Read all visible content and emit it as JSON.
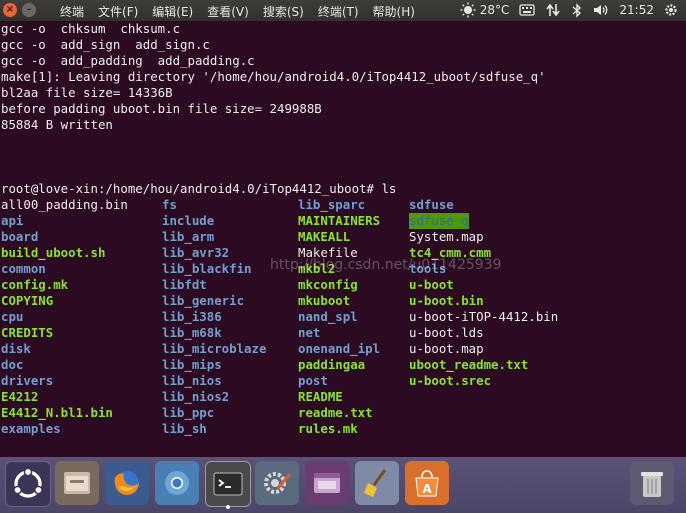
{
  "menubar": {
    "menus": [
      "终端",
      "文件(F)",
      "编辑(E)",
      "查看(V)",
      "搜索(S)",
      "终端(T)",
      "帮助(H)"
    ],
    "temperature": "28°C",
    "time": "21:52",
    "close_glyph": "×",
    "minimize_glyph": "–"
  },
  "terminal": {
    "lines": [
      "gcc -o  chksum  chksum.c",
      "gcc -o  add_sign  add_sign.c",
      "gcc -o  add_padding  add_padding.c",
      "make[1]: Leaving directory '/home/hou/android4.0/iTop4412_uboot/sdfuse_q'",
      "bl2aa file size= 14336B",
      "before padding uboot.bin file size= 249988B",
      "85884 B written",
      "",
      "",
      "",
      "root@love-xin:/home/hou/android4.0/iTop4412_uboot# ls"
    ],
    "ls_columns": [
      [
        {
          "name": "all00_padding.bin",
          "type": "plain"
        },
        {
          "name": "api",
          "type": "dir"
        },
        {
          "name": "board",
          "type": "dir"
        },
        {
          "name": "build_uboot.sh",
          "type": "exec"
        },
        {
          "name": "common",
          "type": "dir"
        },
        {
          "name": "config.mk",
          "type": "exec"
        },
        {
          "name": "COPYING",
          "type": "exec"
        },
        {
          "name": "cpu",
          "type": "dir"
        },
        {
          "name": "CREDITS",
          "type": "exec"
        },
        {
          "name": "disk",
          "type": "dir"
        },
        {
          "name": "doc",
          "type": "dir"
        },
        {
          "name": "drivers",
          "type": "dir"
        },
        {
          "name": "E4212",
          "type": "exec"
        },
        {
          "name": "E4412_N.bl1.bin",
          "type": "exec"
        },
        {
          "name": "examples",
          "type": "dir"
        }
      ],
      [
        {
          "name": "fs",
          "type": "dir"
        },
        {
          "name": "include",
          "type": "dir"
        },
        {
          "name": "lib_arm",
          "type": "dir"
        },
        {
          "name": "lib_avr32",
          "type": "dir"
        },
        {
          "name": "lib_blackfin",
          "type": "dir"
        },
        {
          "name": "libfdt",
          "type": "dir"
        },
        {
          "name": "lib_generic",
          "type": "dir"
        },
        {
          "name": "lib_i386",
          "type": "dir"
        },
        {
          "name": "lib_m68k",
          "type": "dir"
        },
        {
          "name": "lib_microblaze",
          "type": "dir"
        },
        {
          "name": "lib_mips",
          "type": "dir"
        },
        {
          "name": "lib_nios",
          "type": "dir"
        },
        {
          "name": "lib_nios2",
          "type": "dir"
        },
        {
          "name": "lib_ppc",
          "type": "dir"
        },
        {
          "name": "lib_sh",
          "type": "dir"
        }
      ],
      [
        {
          "name": "lib_sparc",
          "type": "dir"
        },
        {
          "name": "MAINTAINERS",
          "type": "exec"
        },
        {
          "name": "MAKEALL",
          "type": "exec"
        },
        {
          "name": "Makefile",
          "type": "plain"
        },
        {
          "name": "mkbl2",
          "type": "exec"
        },
        {
          "name": "mkconfig",
          "type": "exec"
        },
        {
          "name": "mkuboot",
          "type": "exec"
        },
        {
          "name": "nand_spl",
          "type": "dir"
        },
        {
          "name": "net",
          "type": "dir"
        },
        {
          "name": "onenand_ipl",
          "type": "dir"
        },
        {
          "name": "paddingaa",
          "type": "exec"
        },
        {
          "name": "post",
          "type": "dir"
        },
        {
          "name": "README",
          "type": "exec"
        },
        {
          "name": "readme.txt",
          "type": "exec"
        },
        {
          "name": "rules.mk",
          "type": "exec"
        }
      ],
      [
        {
          "name": "sdfuse",
          "type": "dir"
        },
        {
          "name": "sdfuse_q",
          "type": "hl"
        },
        {
          "name": "System.map",
          "type": "plain"
        },
        {
          "name": "tc4_cmm.cmm",
          "type": "exec"
        },
        {
          "name": "tools",
          "type": "dir"
        },
        {
          "name": "u-boot",
          "type": "exec"
        },
        {
          "name": "u-boot.bin",
          "type": "exec"
        },
        {
          "name": "u-boot-iTOP-4412.bin",
          "type": "plain"
        },
        {
          "name": "u-boot.lds",
          "type": "plain"
        },
        {
          "name": "u-boot.map",
          "type": "plain"
        },
        {
          "name": "uboot_readme.txt",
          "type": "exec"
        },
        {
          "name": "u-boot.srec",
          "type": "exec"
        }
      ]
    ],
    "watermark": "http://blog.csdn.net/u011425939",
    "colors": {
      "background": "#2c0a22",
      "text": "#eeeeec",
      "directory": "#729fcf",
      "executable": "#8ae234",
      "highlight_bg": "#4e9a06",
      "highlight_fg": "#3465a4"
    }
  },
  "dock": {
    "items": [
      {
        "icon": "ubuntu-logo-icon",
        "active": false
      },
      {
        "icon": "file-manager-icon",
        "active": false
      },
      {
        "icon": "firefox-icon",
        "active": false
      },
      {
        "icon": "chromium-icon",
        "active": false
      },
      {
        "icon": "terminal-icon",
        "active": true
      },
      {
        "icon": "system-settings-icon",
        "active": false
      },
      {
        "icon": "workspace-switcher-icon",
        "active": false
      },
      {
        "icon": "bleachbit-icon",
        "active": false
      },
      {
        "icon": "software-center-icon",
        "active": false
      },
      {
        "icon": "trash-icon",
        "active": false
      }
    ]
  }
}
